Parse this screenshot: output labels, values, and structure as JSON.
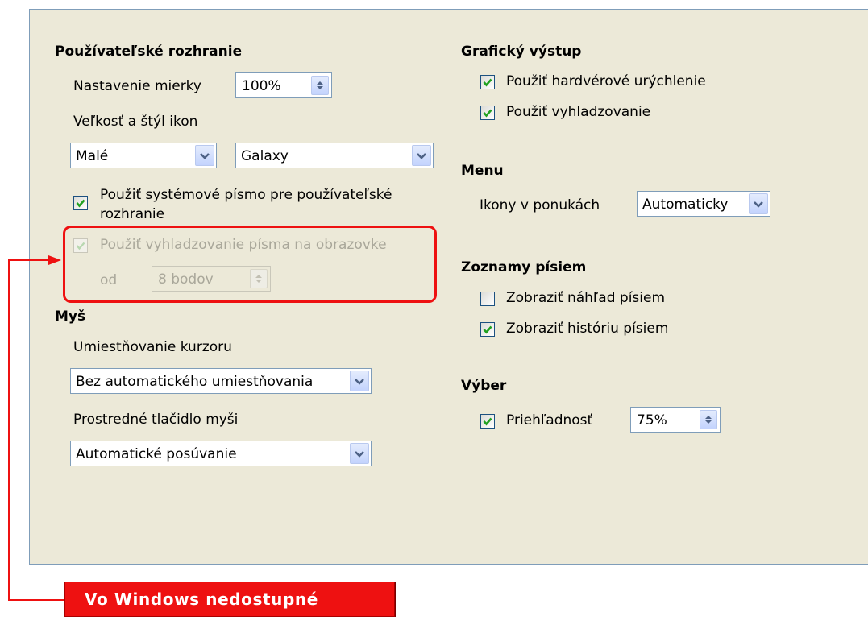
{
  "ui": {
    "heading": "Používateľské rozhranie",
    "scale_label": "Nastavenie mierky",
    "scale_value": "100%",
    "icon_size_style_label": "Veľkosť a štýl ikon",
    "icon_size_value": "Malé",
    "icon_style_value": "Galaxy",
    "system_font_label_line1": "Použiť systémové písmo pre používateľské",
    "system_font_label_line2": "rozhranie",
    "system_font_checked": true,
    "antialias_label": "Použiť vyhladzovanie písma na obrazovke",
    "antialias_checked": true,
    "antialias_from_label": "od",
    "antialias_from_value": "8 bodov"
  },
  "mouse": {
    "heading": "Myš",
    "cursor_positioning_label": "Umiestňovanie kurzoru",
    "cursor_positioning_value": "Bez automatického umiestňovania",
    "middle_button_label": "Prostredné tlačidlo myši",
    "middle_button_value": "Automatické posúvanie"
  },
  "graphics": {
    "heading": "Grafický výstup",
    "hw_accel_label": "Použiť hardvérové urýchlenie",
    "hw_accel_checked": true,
    "antialiasing_label": "Použiť vyhladzovanie",
    "antialiasing_checked": true
  },
  "menu": {
    "heading": "Menu",
    "icons_in_menus_label": "Ikony v ponukách",
    "icons_in_menus_value": "Automaticky"
  },
  "font_lists": {
    "heading": "Zoznamy písiem",
    "preview_label": "Zobraziť náhľad písiem",
    "preview_checked": false,
    "history_label": "Zobraziť históriu písiem",
    "history_checked": true
  },
  "selection": {
    "heading": "Výber",
    "transparency_label": "Priehľadnosť",
    "transparency_checked": true,
    "transparency_value": "75%"
  },
  "annotation": {
    "callout_text": "Vo Windows nedostupné",
    "color": "#ee1111"
  },
  "colors": {
    "panel_bg": "#ece9d8",
    "check_green": "#21a121",
    "field_border": "#7f9db9"
  }
}
